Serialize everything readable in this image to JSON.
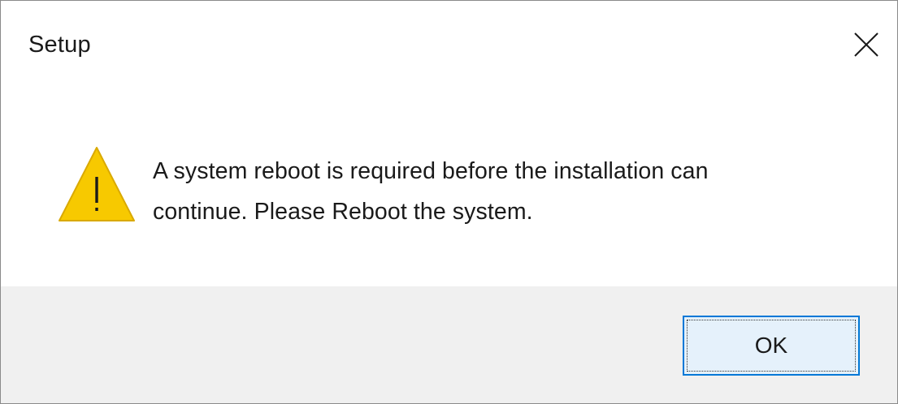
{
  "window": {
    "title": "Setup",
    "close_icon": "close-icon"
  },
  "content": {
    "icon": "warning-icon",
    "message_lines": [
      "A system reboot is required before the installation can",
      "continue. Please Reboot the system."
    ]
  },
  "footer": {
    "ok_label": "OK"
  },
  "colors": {
    "warning_fill": "#f7c900",
    "warning_stroke": "#d9a900",
    "button_bg": "#e5f1fb",
    "button_border": "#0078d7",
    "footer_bg": "#f0f0f0"
  }
}
